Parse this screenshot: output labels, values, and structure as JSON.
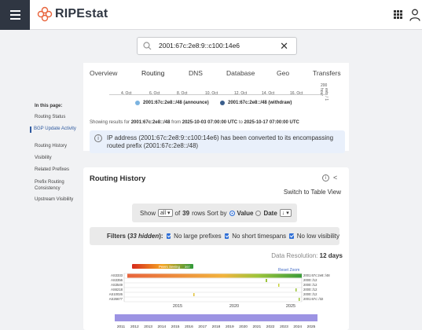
{
  "header": {
    "logo_text": "RIPEstat",
    "brand_color": "#e8643c"
  },
  "search": {
    "value": "2001:67c:2e8:9::c100:14e6",
    "clear_glyph": "✕"
  },
  "tabs": [
    {
      "label": "Overview"
    },
    {
      "label": "Routing",
      "active": true
    },
    {
      "label": "DNS"
    },
    {
      "label": "Database"
    },
    {
      "label": "Geo"
    },
    {
      "label": "Transfers"
    }
  ],
  "activity_chart": {
    "x_ticks": [
      "4. Oct",
      "6. Oct",
      "8. Oct",
      "10. Oct",
      "12. Oct",
      "14. Oct",
      "16. Oct"
    ],
    "y_top": "200",
    "y_label": "evts / 1 hour",
    "legend": [
      {
        "label": "2001:67c:2e8::/48 (announce)",
        "color": "#7bb3e0"
      },
      {
        "label": "2001:67c:2e8::/48 (withdraw)",
        "color": "#3a5e8c"
      }
    ]
  },
  "showing": {
    "prefix": "Showing results for",
    "resource": "2001:67c:2e8::/48",
    "from_word": "from",
    "from": "2025-10-03 07:00:00 UTC",
    "to_word": "to",
    "to": "2025-10-17 07:00:00 UTC"
  },
  "info": {
    "text": "IP address (2001:67c:2e8:9::c100:14e6) has been converted to its encompassing routed prefix (2001:67c:2e8::/48)"
  },
  "nav": {
    "heading": "In this page:",
    "items": [
      {
        "label": "Routing Status"
      },
      {
        "label": "BGP Update Activity",
        "active": true
      },
      {
        "label": "Routing History"
      },
      {
        "label": "Visibility"
      },
      {
        "label": "Related Prefixes"
      },
      {
        "label": "Prefix Routing Consistency"
      },
      {
        "label": "Upstream Visibility"
      }
    ]
  },
  "routing_history": {
    "title": "Routing History",
    "switch_label": "Switch to Table View",
    "show_label": "Show",
    "show_select": "all",
    "of_label": "of",
    "total": "39",
    "rows_label": "rows Sort by",
    "sort_value": "Value",
    "sort_date": "Date",
    "sort_dir": "↓",
    "filters_label": "Filters (",
    "hidden_count": "33 hidden",
    "filters_close": "):",
    "filter_1": "No large prefixes",
    "filter_2": "No short timespans",
    "filter_3": "No low visibility",
    "data_res_label": "Data Resolution:",
    "data_res_value": "12 days",
    "peers_seeing": "Peers Seeing",
    "peers_max": "397",
    "reset_zoom": "Reset Zoom",
    "asns": [
      "AS3333",
      "AS3356",
      "AS3549",
      "AS6218",
      "AS10026",
      "AS26677"
    ],
    "prefixes": [
      "2001:67c:2e8::/48",
      "2000::/12",
      "2000::/12",
      "2000::/12",
      "2000::/12",
      "2001:67c::/32"
    ],
    "year_ticks": [
      "2015",
      "2020",
      "2025"
    ],
    "nav_years": [
      "2011",
      "2012",
      "2013",
      "2014",
      "2015",
      "2016",
      "2017",
      "2018",
      "2019",
      "2020",
      "2021",
      "2022",
      "2023",
      "2024",
      "2025"
    ]
  }
}
